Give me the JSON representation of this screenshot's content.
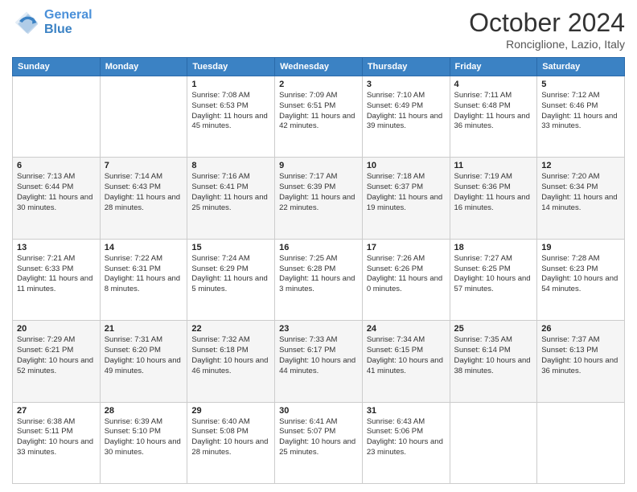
{
  "logo": {
    "line1": "General",
    "line2": "Blue"
  },
  "title": "October 2024",
  "location": "Ronciglione, Lazio, Italy",
  "headers": [
    "Sunday",
    "Monday",
    "Tuesday",
    "Wednesday",
    "Thursday",
    "Friday",
    "Saturday"
  ],
  "weeks": [
    [
      {
        "day": "",
        "sunrise": "",
        "sunset": "",
        "daylight": ""
      },
      {
        "day": "",
        "sunrise": "",
        "sunset": "",
        "daylight": ""
      },
      {
        "day": "1",
        "sunrise": "Sunrise: 7:08 AM",
        "sunset": "Sunset: 6:53 PM",
        "daylight": "Daylight: 11 hours and 45 minutes."
      },
      {
        "day": "2",
        "sunrise": "Sunrise: 7:09 AM",
        "sunset": "Sunset: 6:51 PM",
        "daylight": "Daylight: 11 hours and 42 minutes."
      },
      {
        "day": "3",
        "sunrise": "Sunrise: 7:10 AM",
        "sunset": "Sunset: 6:49 PM",
        "daylight": "Daylight: 11 hours and 39 minutes."
      },
      {
        "day": "4",
        "sunrise": "Sunrise: 7:11 AM",
        "sunset": "Sunset: 6:48 PM",
        "daylight": "Daylight: 11 hours and 36 minutes."
      },
      {
        "day": "5",
        "sunrise": "Sunrise: 7:12 AM",
        "sunset": "Sunset: 6:46 PM",
        "daylight": "Daylight: 11 hours and 33 minutes."
      }
    ],
    [
      {
        "day": "6",
        "sunrise": "Sunrise: 7:13 AM",
        "sunset": "Sunset: 6:44 PM",
        "daylight": "Daylight: 11 hours and 30 minutes."
      },
      {
        "day": "7",
        "sunrise": "Sunrise: 7:14 AM",
        "sunset": "Sunset: 6:43 PM",
        "daylight": "Daylight: 11 hours and 28 minutes."
      },
      {
        "day": "8",
        "sunrise": "Sunrise: 7:16 AM",
        "sunset": "Sunset: 6:41 PM",
        "daylight": "Daylight: 11 hours and 25 minutes."
      },
      {
        "day": "9",
        "sunrise": "Sunrise: 7:17 AM",
        "sunset": "Sunset: 6:39 PM",
        "daylight": "Daylight: 11 hours and 22 minutes."
      },
      {
        "day": "10",
        "sunrise": "Sunrise: 7:18 AM",
        "sunset": "Sunset: 6:37 PM",
        "daylight": "Daylight: 11 hours and 19 minutes."
      },
      {
        "day": "11",
        "sunrise": "Sunrise: 7:19 AM",
        "sunset": "Sunset: 6:36 PM",
        "daylight": "Daylight: 11 hours and 16 minutes."
      },
      {
        "day": "12",
        "sunrise": "Sunrise: 7:20 AM",
        "sunset": "Sunset: 6:34 PM",
        "daylight": "Daylight: 11 hours and 14 minutes."
      }
    ],
    [
      {
        "day": "13",
        "sunrise": "Sunrise: 7:21 AM",
        "sunset": "Sunset: 6:33 PM",
        "daylight": "Daylight: 11 hours and 11 minutes."
      },
      {
        "day": "14",
        "sunrise": "Sunrise: 7:22 AM",
        "sunset": "Sunset: 6:31 PM",
        "daylight": "Daylight: 11 hours and 8 minutes."
      },
      {
        "day": "15",
        "sunrise": "Sunrise: 7:24 AM",
        "sunset": "Sunset: 6:29 PM",
        "daylight": "Daylight: 11 hours and 5 minutes."
      },
      {
        "day": "16",
        "sunrise": "Sunrise: 7:25 AM",
        "sunset": "Sunset: 6:28 PM",
        "daylight": "Daylight: 11 hours and 3 minutes."
      },
      {
        "day": "17",
        "sunrise": "Sunrise: 7:26 AM",
        "sunset": "Sunset: 6:26 PM",
        "daylight": "Daylight: 11 hours and 0 minutes."
      },
      {
        "day": "18",
        "sunrise": "Sunrise: 7:27 AM",
        "sunset": "Sunset: 6:25 PM",
        "daylight": "Daylight: 10 hours and 57 minutes."
      },
      {
        "day": "19",
        "sunrise": "Sunrise: 7:28 AM",
        "sunset": "Sunset: 6:23 PM",
        "daylight": "Daylight: 10 hours and 54 minutes."
      }
    ],
    [
      {
        "day": "20",
        "sunrise": "Sunrise: 7:29 AM",
        "sunset": "Sunset: 6:21 PM",
        "daylight": "Daylight: 10 hours and 52 minutes."
      },
      {
        "day": "21",
        "sunrise": "Sunrise: 7:31 AM",
        "sunset": "Sunset: 6:20 PM",
        "daylight": "Daylight: 10 hours and 49 minutes."
      },
      {
        "day": "22",
        "sunrise": "Sunrise: 7:32 AM",
        "sunset": "Sunset: 6:18 PM",
        "daylight": "Daylight: 10 hours and 46 minutes."
      },
      {
        "day": "23",
        "sunrise": "Sunrise: 7:33 AM",
        "sunset": "Sunset: 6:17 PM",
        "daylight": "Daylight: 10 hours and 44 minutes."
      },
      {
        "day": "24",
        "sunrise": "Sunrise: 7:34 AM",
        "sunset": "Sunset: 6:15 PM",
        "daylight": "Daylight: 10 hours and 41 minutes."
      },
      {
        "day": "25",
        "sunrise": "Sunrise: 7:35 AM",
        "sunset": "Sunset: 6:14 PM",
        "daylight": "Daylight: 10 hours and 38 minutes."
      },
      {
        "day": "26",
        "sunrise": "Sunrise: 7:37 AM",
        "sunset": "Sunset: 6:13 PM",
        "daylight": "Daylight: 10 hours and 36 minutes."
      }
    ],
    [
      {
        "day": "27",
        "sunrise": "Sunrise: 6:38 AM",
        "sunset": "Sunset: 5:11 PM",
        "daylight": "Daylight: 10 hours and 33 minutes."
      },
      {
        "day": "28",
        "sunrise": "Sunrise: 6:39 AM",
        "sunset": "Sunset: 5:10 PM",
        "daylight": "Daylight: 10 hours and 30 minutes."
      },
      {
        "day": "29",
        "sunrise": "Sunrise: 6:40 AM",
        "sunset": "Sunset: 5:08 PM",
        "daylight": "Daylight: 10 hours and 28 minutes."
      },
      {
        "day": "30",
        "sunrise": "Sunrise: 6:41 AM",
        "sunset": "Sunset: 5:07 PM",
        "daylight": "Daylight: 10 hours and 25 minutes."
      },
      {
        "day": "31",
        "sunrise": "Sunrise: 6:43 AM",
        "sunset": "Sunset: 5:06 PM",
        "daylight": "Daylight: 10 hours and 23 minutes."
      },
      {
        "day": "",
        "sunrise": "",
        "sunset": "",
        "daylight": ""
      },
      {
        "day": "",
        "sunrise": "",
        "sunset": "",
        "daylight": ""
      }
    ]
  ]
}
